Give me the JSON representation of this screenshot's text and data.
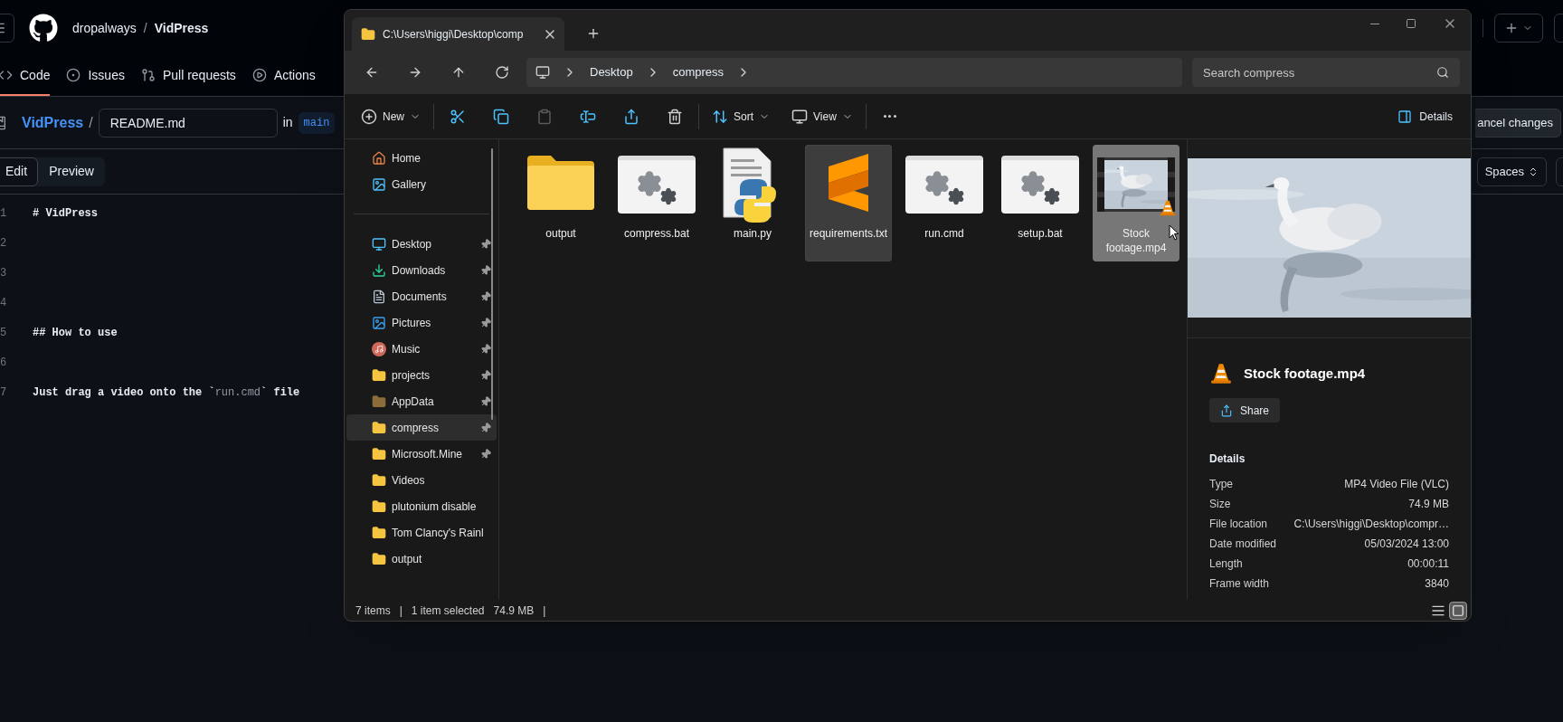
{
  "github": {
    "owner": "dropalways",
    "separator": "/",
    "repo": "VidPress",
    "nav_tabs": [
      {
        "label": "Code",
        "kind": "code",
        "selected": true
      },
      {
        "label": "Issues",
        "kind": "issues",
        "selected": false
      },
      {
        "label": "Pull requests",
        "kind": "pulls",
        "selected": false
      },
      {
        "label": "Actions",
        "kind": "actions",
        "selected": false
      }
    ],
    "breadcrumb": {
      "repo": "VidPress",
      "separator": "/",
      "file_name": "README.md",
      "in_label": "in",
      "branch": "main"
    },
    "cancel_button": "ancel changes",
    "editor_tabs": [
      {
        "label": "Edit",
        "selected": true
      },
      {
        "label": "Preview",
        "selected": false
      }
    ],
    "indent_button": "Spaces",
    "lines": [
      {
        "number": "1",
        "segments": [
          {
            "text": "# VidPress",
            "kind": "plain"
          }
        ]
      },
      {
        "number": "2"
      },
      {
        "number": "3"
      },
      {
        "number": "4"
      },
      {
        "number": "5",
        "segments": [
          {
            "text": "## How to use",
            "kind": "plain"
          }
        ]
      },
      {
        "number": "6"
      },
      {
        "number": "7",
        "segments": [
          {
            "text": "Just drag a video onto the `",
            "kind": "plain"
          },
          {
            "text": "run.cmd",
            "kind": "code"
          },
          {
            "text": "` file",
            "kind": "plain"
          }
        ]
      }
    ]
  },
  "explorer": {
    "tab": {
      "title": "C:\\Users\\higgi\\Desktop\\comp"
    },
    "breadcrumb": [
      "Desktop",
      "compress"
    ],
    "search": {
      "placeholder": "Search compress"
    },
    "toolbar_groups": [
      {
        "items": [
          {
            "kind": "new",
            "label": "New",
            "dropdown": true,
            "disabled": false
          }
        ]
      },
      {
        "items": [
          {
            "kind": "cut",
            "dropdown": false,
            "disabled": false
          },
          {
            "kind": "copy",
            "dropdown": false,
            "disabled": false
          },
          {
            "kind": "paste",
            "dropdown": false,
            "disabled": true
          },
          {
            "kind": "rename",
            "dropdown": false,
            "disabled": false
          },
          {
            "kind": "share",
            "dropdown": false,
            "disabled": false
          },
          {
            "kind": "delete",
            "dropdown": false,
            "disabled": false
          }
        ]
      },
      {
        "items": [
          {
            "kind": "sort",
            "label": "Sort",
            "dropdown": true,
            "disabled": false
          },
          {
            "kind": "view",
            "label": "View",
            "dropdown": true,
            "disabled": false
          }
        ]
      },
      {
        "items": [
          {
            "kind": "more",
            "dropdown": false,
            "disabled": false
          }
        ]
      }
    ],
    "details_button": "Details",
    "sidebar_top": [
      {
        "label": "Home",
        "kind": "home",
        "pinned": false,
        "selected": false
      },
      {
        "label": "Gallery",
        "kind": "gallery",
        "pinned": false,
        "selected": false
      }
    ],
    "sidebar_quick": [
      {
        "label": "Desktop",
        "kind": "desktop",
        "pinned": true,
        "selected": false
      },
      {
        "label": "Downloads",
        "kind": "downloads",
        "pinned": true,
        "selected": false
      },
      {
        "label": "Documents",
        "kind": "documents",
        "pinned": true,
        "selected": false
      },
      {
        "label": "Pictures",
        "kind": "pictures",
        "pinned": true,
        "selected": false
      },
      {
        "label": "Music",
        "kind": "music",
        "pinned": true,
        "selected": false
      },
      {
        "label": "projects",
        "kind": "folder",
        "pinned": true,
        "selected": false
      },
      {
        "label": "AppData",
        "kind": "folder-dim",
        "pinned": true,
        "selected": false
      },
      {
        "label": "compress",
        "kind": "folder",
        "pinned": true,
        "selected": true
      },
      {
        "label": "Microsoft.Mine",
        "kind": "folder",
        "pinned": true,
        "selected": false
      },
      {
        "label": "Videos",
        "kind": "folder",
        "pinned": false,
        "selected": false
      },
      {
        "label": "plutonium disable",
        "kind": "folder",
        "pinned": false,
        "selected": false
      },
      {
        "label": "Tom Clancy's Rainl",
        "kind": "folder",
        "pinned": false,
        "selected": false
      },
      {
        "label": "output",
        "kind": "folder",
        "pinned": false,
        "selected": false
      }
    ],
    "files": [
      {
        "name": "output",
        "kind": "folder",
        "selected": false,
        "hovered": false
      },
      {
        "name": "compress.bat",
        "kind": "script",
        "selected": false,
        "hovered": false
      },
      {
        "name": "main.py",
        "kind": "python",
        "selected": false,
        "hovered": false
      },
      {
        "name": "requirements.txt",
        "kind": "text",
        "selected": false,
        "hovered": true
      },
      {
        "name": "run.cmd",
        "kind": "script",
        "selected": false,
        "hovered": false
      },
      {
        "name": "setup.bat",
        "kind": "script",
        "selected": false,
        "hovered": false
      },
      {
        "name": "Stock footage.mp4",
        "kind": "video",
        "selected": true,
        "hovered": false
      }
    ],
    "details_pane": {
      "title": "Stock footage.mp4",
      "share_button": "Share",
      "heading": "Details",
      "properties": [
        {
          "label": "Type",
          "value": "MP4 Video File (VLC)"
        },
        {
          "label": "Size",
          "value": "74.9 MB"
        },
        {
          "label": "File location",
          "value": "C:\\Users\\higgi\\Desktop\\compr…"
        },
        {
          "label": "Date modified",
          "value": "05/03/2024 13:00"
        },
        {
          "label": "Length",
          "value": "00:00:11"
        },
        {
          "label": "Frame width",
          "value": "3840"
        }
      ]
    },
    "status_bar": [
      "7 items",
      "|",
      "1 item selected",
      "74.9 MB",
      "|"
    ],
    "view_modes": [
      {
        "kind": "details",
        "selected": false
      },
      {
        "kind": "large-icons",
        "selected": true
      }
    ]
  }
}
